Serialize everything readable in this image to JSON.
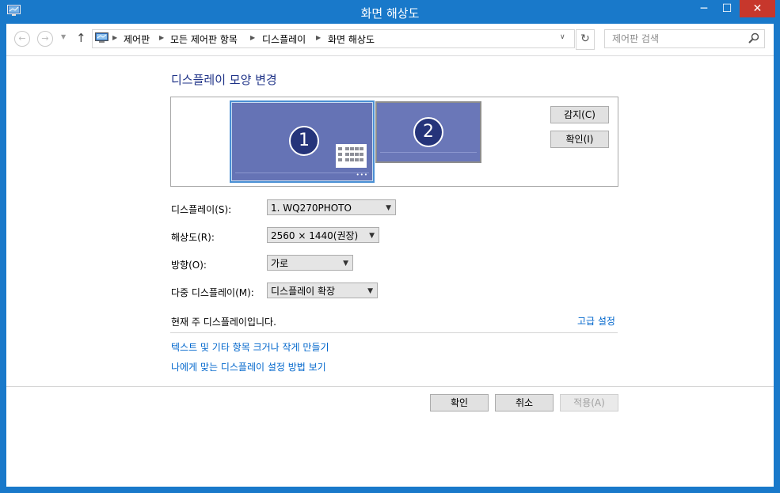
{
  "window": {
    "title": "화면 해상도",
    "min_label": "─",
    "max_label": "☐",
    "close_label": "✕"
  },
  "nav": {
    "back_icon": "←",
    "forward_icon": "→",
    "recent_icon": "▼",
    "up_icon": "↑",
    "breadcrumbs": [
      "제어판",
      "모든 제어판 항목",
      "디스플레이",
      "화면 해상도"
    ],
    "separator": "▶",
    "dropdown_icon": "∨",
    "refresh_icon": "↻",
    "search_placeholder": "제어판 검색"
  },
  "main": {
    "heading": "디스플레이 모양 변경",
    "monitors": [
      {
        "number": "1",
        "primary": true
      },
      {
        "number": "2",
        "primary": false
      }
    ],
    "monitor_dots": "•••",
    "detect_label": "감지(C)",
    "identify_label": "확인(I)",
    "fields": [
      {
        "label": "디스플레이(S):",
        "value": "1. WQ270PHOTO"
      },
      {
        "label": "해상도(R):",
        "value": "2560 × 1440(권장)"
      },
      {
        "label": "방향(O):",
        "value": "가로"
      },
      {
        "label": "다중 디스플레이(M):",
        "value": "디스플레이 확장"
      }
    ],
    "dropdown_arrow": "▼",
    "current_main": "현재 주 디스플레이입니다.",
    "advanced_link": "고급 설정",
    "links": [
      "텍스트 및 기타 항목 크거나 작게 만들기",
      "나에게 맞는 디스플레이 설정 방법 보기"
    ]
  },
  "footer": {
    "ok_label": "확인",
    "cancel_label": "취소",
    "apply_label": "적용(A)",
    "apply_enabled": false
  },
  "colors": {
    "frame": "#1979ca",
    "close": "#c7372c",
    "link": "#0066cc",
    "heading": "#1e3287",
    "monitor": "#6a77b8",
    "monitor_number": "#25347a"
  }
}
